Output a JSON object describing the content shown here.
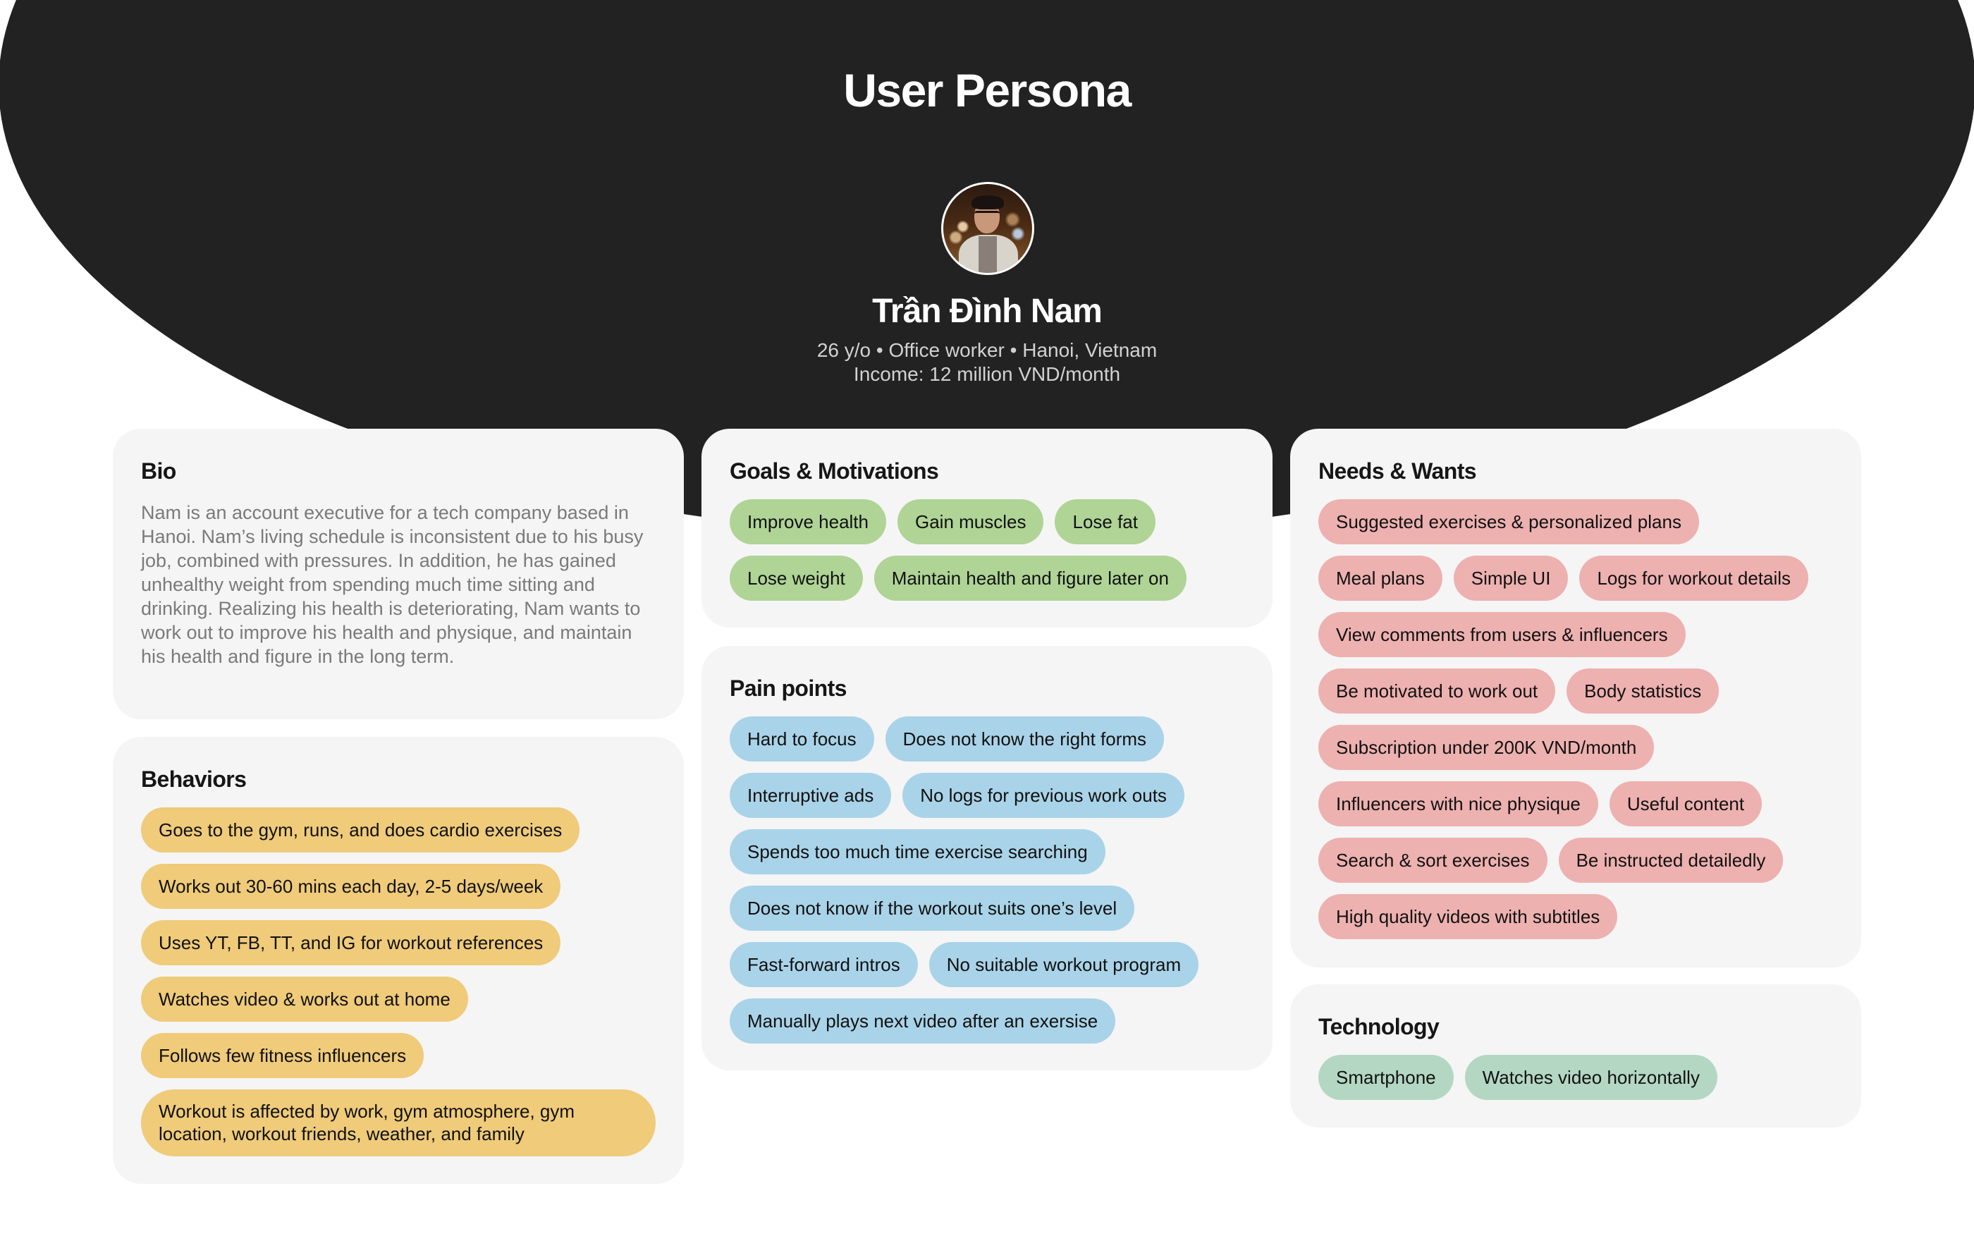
{
  "header": {
    "title": "User Persona",
    "name": "Trần Đình Nam",
    "meta_line1": "26 y/o • Office worker • Hanoi, Vietnam",
    "meta_line2": "Income: 12 million VND/month"
  },
  "colors": {
    "hero": "#222222",
    "card": "#F5F5F5",
    "behaviors": "#EFCB7A",
    "goals": "#AFD496",
    "pain": "#A9D3E8",
    "needs": "#EDB1B0",
    "tech": "#B3D7C3"
  },
  "bio": {
    "title": "Bio",
    "text": "Nam is an account executive for a tech company based in Hanoi. Nam’s living schedule is inconsistent due to his busy job, combined with pressures. In addition, he has gained unhealthy weight from spending much time sitting and drinking. Realizing his health is deteriorating, Nam wants to work out to improve his health and physique, and maintain his health and figure in the long term."
  },
  "behaviors": {
    "title": "Behaviors",
    "items": [
      "Goes to the gym, runs, and does cardio exercises",
      "Works out 30-60 mins each day, 2-5 days/week",
      "Uses YT, FB, TT, and IG for workout references",
      "Watches video & works out at home",
      "Follows few fitness influencers",
      "Workout is affected by work, gym atmosphere, gym location, workout friends, weather, and family"
    ]
  },
  "goals": {
    "title": "Goals & Motivations",
    "items": [
      "Improve health",
      "Gain muscles",
      "Lose fat",
      "Lose weight",
      "Maintain health and figure later on"
    ]
  },
  "pain_points": {
    "title": "Pain points",
    "items": [
      "Hard to focus",
      "Does not know the right forms",
      "Interruptive ads",
      "No logs for previous work outs",
      "Spends too much time exercise searching",
      "Does not know if the workout suits one’s level",
      "Fast-forward intros",
      "No suitable workout program",
      "Manually plays next video after an exersise"
    ]
  },
  "needs": {
    "title": "Needs & Wants",
    "items": [
      "Suggested exercises & personalized plans",
      "Meal plans",
      "Simple UI",
      "Logs for workout details",
      "View comments from users & influencers",
      "Be motivated to work out",
      "Body statistics",
      "Subscription under 200K VND/month",
      "Influencers with nice physique",
      "Useful content",
      "Search & sort exercises",
      "Be instructed detailedly",
      "High quality videos with subtitles"
    ]
  },
  "technology": {
    "title": "Technology",
    "items": [
      "Smartphone",
      "Watches video horizontally"
    ]
  }
}
